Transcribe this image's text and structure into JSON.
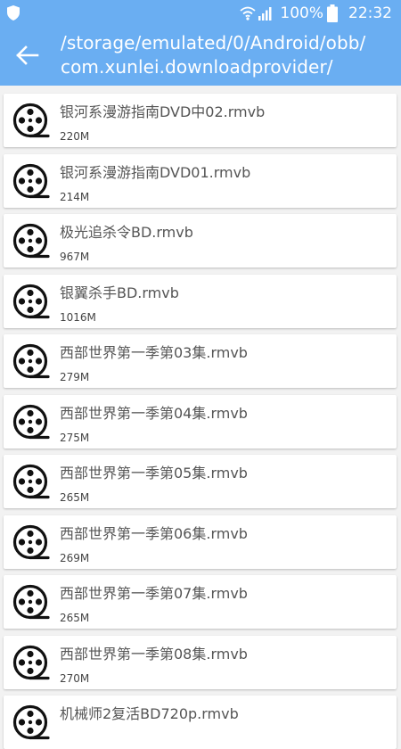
{
  "status_bar": {
    "battery_percent": "100%",
    "time": "22:32",
    "icons": [
      "shield-icon",
      "wifi-icon",
      "signal-icon",
      "battery-icon"
    ]
  },
  "app_bar": {
    "back_icon": "arrow-left-icon",
    "path": "/storage/emulated/0/Android/obb/\ncom.xunlei.downloadprovider/"
  },
  "files": [
    {
      "name": "银河系漫游指南DVD中02.rmvb",
      "size": "220M",
      "icon": "film-reel-icon"
    },
    {
      "name": "银河系漫游指南DVD01.rmvb",
      "size": "214M",
      "icon": "film-reel-icon"
    },
    {
      "name": "极光追杀令BD.rmvb",
      "size": "967M",
      "icon": "film-reel-icon"
    },
    {
      "name": "银翼杀手BD.rmvb",
      "size": "1016M",
      "icon": "film-reel-icon"
    },
    {
      "name": "西部世界第一季第03集.rmvb",
      "size": "279M",
      "icon": "film-reel-icon"
    },
    {
      "name": "西部世界第一季第04集.rmvb",
      "size": "275M",
      "icon": "film-reel-icon"
    },
    {
      "name": "西部世界第一季第05集.rmvb",
      "size": "265M",
      "icon": "film-reel-icon"
    },
    {
      "name": "西部世界第一季第06集.rmvb",
      "size": "269M",
      "icon": "film-reel-icon"
    },
    {
      "name": "西部世界第一季第07集.rmvb",
      "size": "265M",
      "icon": "film-reel-icon"
    },
    {
      "name": "西部世界第一季第08集.rmvb",
      "size": "270M",
      "icon": "film-reel-icon"
    },
    {
      "name": "机械师2复活BD720p.rmvb",
      "size": "",
      "icon": "film-reel-icon"
    }
  ],
  "colors": {
    "accent": "#6aaef2",
    "background": "#f2f2f2"
  }
}
